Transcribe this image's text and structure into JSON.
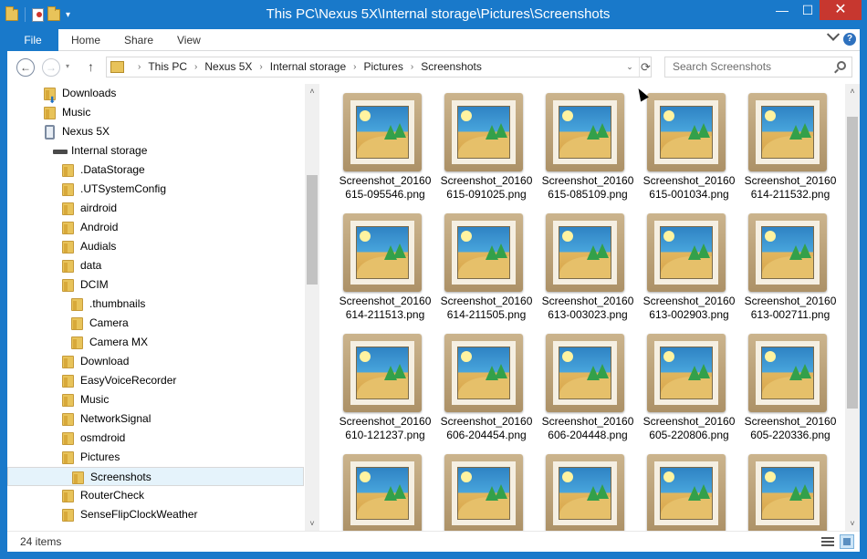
{
  "window": {
    "title": "This PC\\Nexus 5X\\Internal storage\\Pictures\\Screenshots",
    "controls": {
      "minimize": "—",
      "maximize": "☐",
      "close": "✕"
    }
  },
  "ribbon": {
    "tabs": [
      "File",
      "Home",
      "Share",
      "View"
    ],
    "help": "?"
  },
  "nav": {
    "back_icon": "←",
    "forward_icon": "→",
    "history_icon": "▾",
    "up_icon": "↑",
    "breadcrumbs": [
      "This PC",
      "Nexus 5X",
      "Internal storage",
      "Pictures",
      "Screenshots"
    ],
    "crumb_separator": "›",
    "dropdown_icon": "⌄",
    "refresh_icon": "⟳",
    "search_placeholder": "Search Screenshots"
  },
  "tree": {
    "items": [
      {
        "label": "Downloads",
        "icon": "downloads-folder-icon"
      },
      {
        "label": "Music",
        "icon": "music-folder-icon"
      },
      {
        "label": "Nexus 5X",
        "icon": "phone-icon"
      },
      {
        "label": "Internal storage",
        "icon": "drive-icon"
      },
      {
        "label": ".DataStorage",
        "icon": "folder-icon"
      },
      {
        "label": ".UTSystemConfig",
        "icon": "folder-icon"
      },
      {
        "label": "airdroid",
        "icon": "folder-icon"
      },
      {
        "label": "Android",
        "icon": "folder-icon"
      },
      {
        "label": "Audials",
        "icon": "folder-icon"
      },
      {
        "label": "data",
        "icon": "folder-icon"
      },
      {
        "label": "DCIM",
        "icon": "folder-icon"
      },
      {
        "label": ".thumbnails",
        "icon": "folder-icon"
      },
      {
        "label": "Camera",
        "icon": "folder-icon"
      },
      {
        "label": "Camera MX",
        "icon": "folder-icon"
      },
      {
        "label": "Download",
        "icon": "folder-icon"
      },
      {
        "label": "EasyVoiceRecorder",
        "icon": "folder-icon"
      },
      {
        "label": "Music",
        "icon": "folder-icon"
      },
      {
        "label": "NetworkSignal",
        "icon": "folder-icon"
      },
      {
        "label": "osmdroid",
        "icon": "folder-icon"
      },
      {
        "label": "Pictures",
        "icon": "folder-icon"
      },
      {
        "label": "Screenshots",
        "icon": "folder-icon",
        "selected": true
      },
      {
        "label": "RouterCheck",
        "icon": "folder-icon"
      },
      {
        "label": "SenseFlipClockWeather",
        "icon": "folder-icon"
      }
    ],
    "scroll_up": "˄",
    "scroll_down": "˅"
  },
  "files": [
    {
      "line1": "Screenshot_20160",
      "line2": "615-095546.png"
    },
    {
      "line1": "Screenshot_20160",
      "line2": "615-091025.png"
    },
    {
      "line1": "Screenshot_20160",
      "line2": "615-085109.png"
    },
    {
      "line1": "Screenshot_20160",
      "line2": "615-001034.png"
    },
    {
      "line1": "Screenshot_20160",
      "line2": "614-211532.png"
    },
    {
      "line1": "Screenshot_20160",
      "line2": "614-211513.png"
    },
    {
      "line1": "Screenshot_20160",
      "line2": "614-211505.png"
    },
    {
      "line1": "Screenshot_20160",
      "line2": "613-003023.png"
    },
    {
      "line1": "Screenshot_20160",
      "line2": "613-002903.png"
    },
    {
      "line1": "Screenshot_20160",
      "line2": "613-002711.png"
    },
    {
      "line1": "Screenshot_20160",
      "line2": "610-121237.png"
    },
    {
      "line1": "Screenshot_20160",
      "line2": "606-204454.png"
    },
    {
      "line1": "Screenshot_20160",
      "line2": "606-204448.png"
    },
    {
      "line1": "Screenshot_20160",
      "line2": "605-220806.png"
    },
    {
      "line1": "Screenshot_20160",
      "line2": "605-220336.png"
    },
    {
      "line1": "",
      "line2": ""
    },
    {
      "line1": "",
      "line2": ""
    },
    {
      "line1": "",
      "line2": ""
    },
    {
      "line1": "",
      "line2": ""
    },
    {
      "line1": "",
      "line2": ""
    }
  ],
  "content_scroll": {
    "up": "˄",
    "down": "˅"
  },
  "status": {
    "item_count": "24 items"
  },
  "colors": {
    "accent": "#1979ca",
    "close": "#c7372f",
    "selection": "#e5f3fb"
  }
}
